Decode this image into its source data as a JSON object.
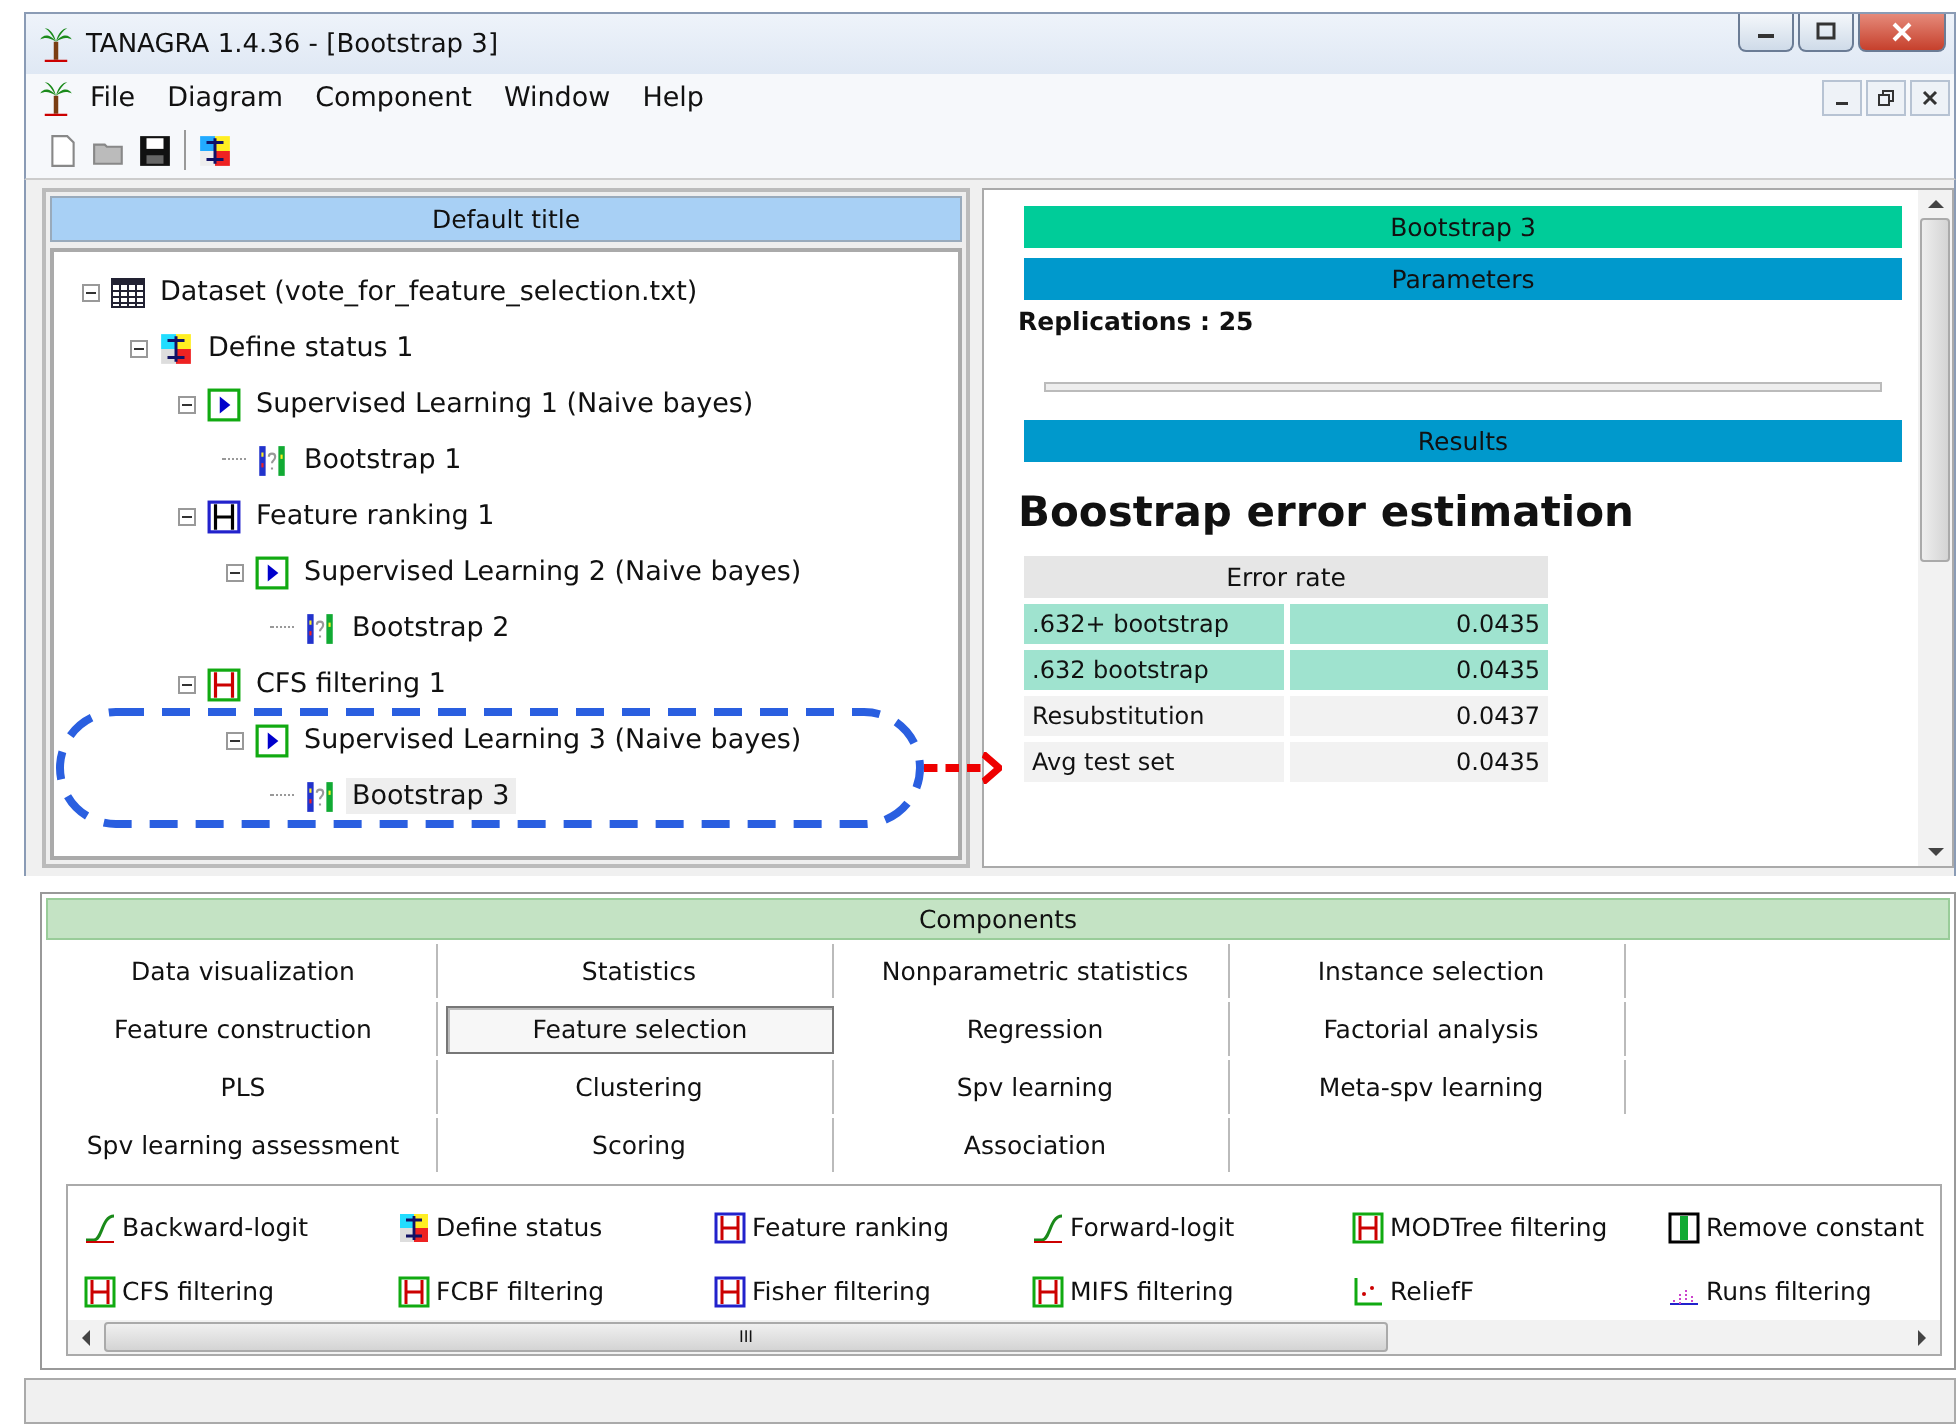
{
  "window": {
    "title": "TANAGRA 1.4.36 - [Bootstrap 3]"
  },
  "menu": [
    "File",
    "Diagram",
    "Component",
    "Window",
    "Help"
  ],
  "diagram": {
    "title": "Default title",
    "tree": [
      {
        "label": "Dataset (vote_for_feature_selection.txt)",
        "kind": "dataset",
        "expanded": true,
        "selected": false,
        "children": [
          {
            "label": "Define status 1",
            "kind": "status",
            "expanded": true,
            "selected": false,
            "children": [
              {
                "label": "Supervised Learning 1 (Naive bayes)",
                "kind": "learner",
                "expanded": true,
                "selected": false,
                "children": [
                  {
                    "label": "Bootstrap 1",
                    "kind": "bootstrap",
                    "selected": false
                  }
                ]
              },
              {
                "label": "Feature ranking 1",
                "kind": "ranking",
                "expanded": true,
                "selected": false,
                "children": [
                  {
                    "label": "Supervised Learning 2 (Naive bayes)",
                    "kind": "learner",
                    "expanded": true,
                    "selected": false,
                    "children": [
                      {
                        "label": "Bootstrap 2",
                        "kind": "bootstrap",
                        "selected": false
                      }
                    ]
                  }
                ]
              },
              {
                "label": "CFS filtering 1",
                "kind": "filter",
                "expanded": true,
                "selected": false,
                "children": [
                  {
                    "label": "Supervised Learning 3 (Naive bayes)",
                    "kind": "learner",
                    "expanded": true,
                    "selected": false,
                    "children": [
                      {
                        "label": "Bootstrap 3",
                        "kind": "bootstrap",
                        "selected": true
                      }
                    ]
                  }
                ]
              }
            ]
          }
        ]
      }
    ]
  },
  "report": {
    "component": "Bootstrap 3",
    "parameters_heading": "Parameters",
    "parameters": "Replications : 25",
    "results_heading": "Results",
    "results_title": "Boostrap error estimation",
    "table": {
      "header": "Error rate",
      "rows": [
        {
          "label": ".632+ bootstrap",
          "value": "0.0435",
          "highlighted": true
        },
        {
          "label": ".632 bootstrap",
          "value": "0.0435",
          "highlighted": true
        },
        {
          "label": "Resubstitution",
          "value": "0.0437",
          "highlighted": false
        },
        {
          "label": "Avg test set",
          "value": "0.0435",
          "highlighted": false
        }
      ]
    }
  },
  "components": {
    "title": "Components",
    "tabs": [
      {
        "label": "Data visualization",
        "selected": false
      },
      {
        "label": "Statistics",
        "selected": false
      },
      {
        "label": "Nonparametric statistics",
        "selected": false
      },
      {
        "label": "Instance selection",
        "selected": false
      },
      {
        "label": "Feature construction",
        "selected": false
      },
      {
        "label": "Feature selection",
        "selected": true
      },
      {
        "label": "Regression",
        "selected": false
      },
      {
        "label": "Factorial analysis",
        "selected": false
      },
      {
        "label": "PLS",
        "selected": false
      },
      {
        "label": "Clustering",
        "selected": false
      },
      {
        "label": "Spv learning",
        "selected": false
      },
      {
        "label": "Meta-spv learning",
        "selected": false
      },
      {
        "label": "Spv learning assessment",
        "selected": false
      },
      {
        "label": "Scoring",
        "selected": false
      },
      {
        "label": "Association",
        "selected": false
      }
    ],
    "items": [
      {
        "label": "Backward-logit",
        "kind": "logit"
      },
      {
        "label": "Define status",
        "kind": "status"
      },
      {
        "label": "Feature ranking",
        "kind": "ranking"
      },
      {
        "label": "Forward-logit",
        "kind": "logit"
      },
      {
        "label": "MODTree filtering",
        "kind": "filter"
      },
      {
        "label": "Remove constant",
        "kind": "constant"
      },
      {
        "label": "CFS filtering",
        "kind": "filter"
      },
      {
        "label": "FCBF filtering",
        "kind": "filter"
      },
      {
        "label": "Fisher filtering",
        "kind": "ranking"
      },
      {
        "label": "MIFS filtering",
        "kind": "filter"
      },
      {
        "label": "ReliefF",
        "kind": "relief"
      },
      {
        "label": "Runs filtering",
        "kind": "runs"
      }
    ],
    "scroll_thumb": "III"
  }
}
